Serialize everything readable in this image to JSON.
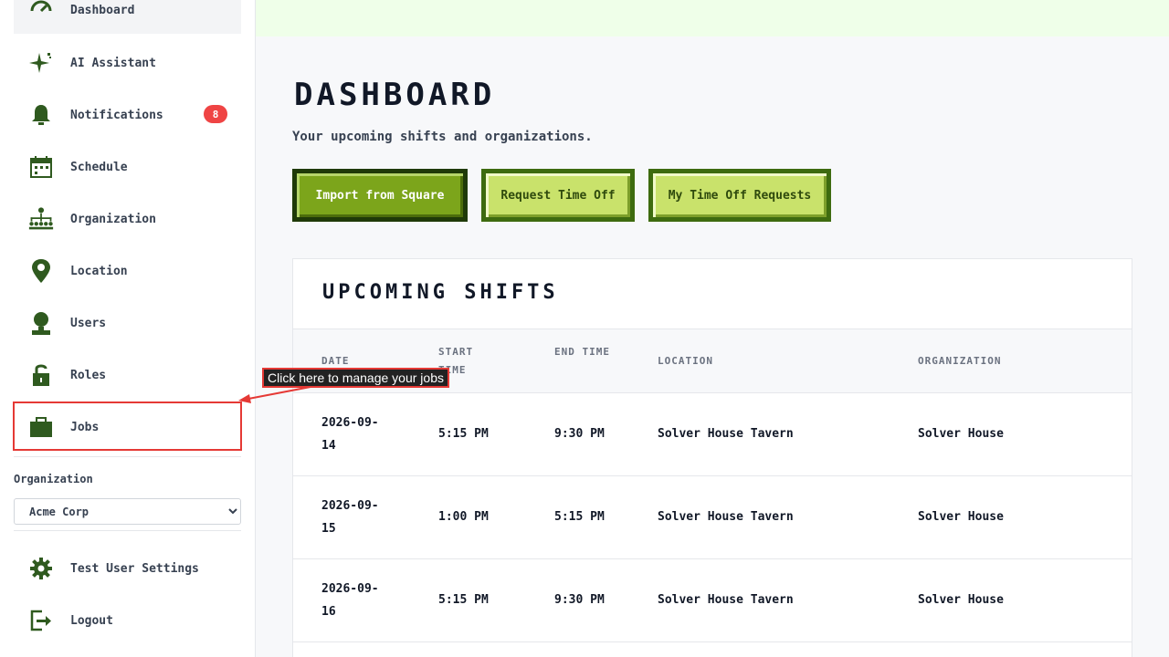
{
  "sidebar": {
    "items": [
      {
        "label": "Dashboard",
        "icon": "dashboard-icon"
      },
      {
        "label": "AI Assistant",
        "icon": "sparkle-icon"
      },
      {
        "label": "Notifications",
        "icon": "bell-icon",
        "badge": "8"
      },
      {
        "label": "Schedule",
        "icon": "calendar-icon"
      },
      {
        "label": "Organization",
        "icon": "org-chart-icon"
      },
      {
        "label": "Location",
        "icon": "map-pin-icon"
      },
      {
        "label": "Users",
        "icon": "user-icon"
      },
      {
        "label": "Roles",
        "icon": "lock-icon"
      },
      {
        "label": "Jobs",
        "icon": "briefcase-icon"
      }
    ],
    "organization_label": "Organization",
    "organization_value": "Acme Corp",
    "bottom_items": [
      {
        "label": "Test User Settings",
        "icon": "gear-icon"
      },
      {
        "label": "Logout",
        "icon": "logout-icon"
      }
    ]
  },
  "main": {
    "title": "DASHBOARD",
    "subtitle": "Your upcoming shifts and organizations.",
    "buttons": {
      "import": "Import from Square",
      "request_time_off": "Request Time Off",
      "my_time_off": "My Time Off Requests"
    },
    "shifts": {
      "title": "UPCOMING SHIFTS",
      "columns": [
        "DATE",
        "START TIME",
        "END TIME",
        "LOCATION",
        "ORGANIZATION"
      ],
      "rows": [
        {
          "date": "2026-09-14",
          "start": "5:15 PM",
          "end": "9:30 PM",
          "location": "Solver House Tavern",
          "organization": "Solver House"
        },
        {
          "date": "2026-09-15",
          "start": "1:00 PM",
          "end": "5:15 PM",
          "location": "Solver House Tavern",
          "organization": "Solver House"
        },
        {
          "date": "2026-09-16",
          "start": "5:15 PM",
          "end": "9:30 PM",
          "location": "Solver House Tavern",
          "organization": "Solver House"
        }
      ]
    }
  },
  "tooltip": {
    "text": "Click here to manage your jobs"
  },
  "colors": {
    "accent": "#7ca51b",
    "topbar": "#efffe9",
    "badge": "#ef4444",
    "highlight": "#e53935",
    "icon": "#2f5a1f"
  }
}
